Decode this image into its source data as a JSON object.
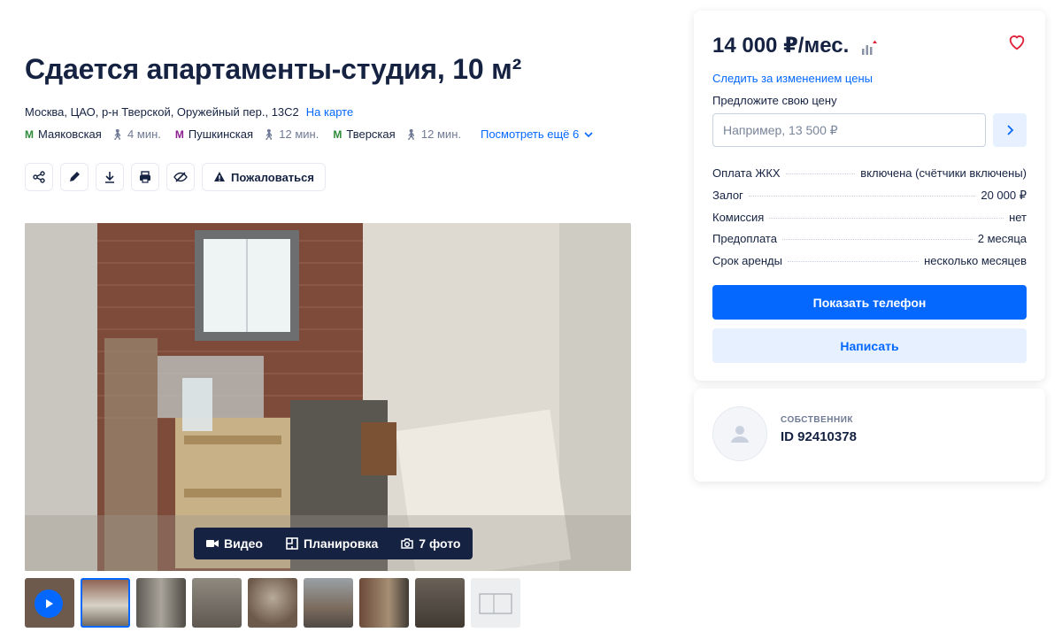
{
  "listing": {
    "title": "Сдается апартаменты-студия, 10 м²",
    "address": "Москва, ЦАО, р-н Тверской, Оружейный пер., 13С2",
    "map_link": "На карте",
    "metro": [
      {
        "name": "Маяковская",
        "walk": "4 мин.",
        "color": "#2e8b3a",
        "symbol": "M"
      },
      {
        "name": "Пушкинская",
        "walk": "12 мин.",
        "color": "#8b1f8e",
        "symbol": "M"
      },
      {
        "name": "Тверская",
        "walk": "12 мин.",
        "color": "#2e8b3a",
        "symbol": "M"
      }
    ],
    "more_metro": "Посмотреть ещё 6",
    "complain": "Пожаловаться"
  },
  "gallery": {
    "video": "Видео",
    "plan": "Планировка",
    "photos": "7 фото",
    "thumb_count": 9
  },
  "sidebar": {
    "price": "14 000 ₽/мес.",
    "follow_price": "Следить за изменением цены",
    "offer_label": "Предложите свою цену",
    "offer_placeholder": "Например, 13 500 ₽",
    "facts": [
      {
        "label": "Оплата ЖКХ",
        "value": "включена (счётчики включены)"
      },
      {
        "label": "Залог",
        "value": "20 000 ₽"
      },
      {
        "label": "Комиссия",
        "value": "нет"
      },
      {
        "label": "Предоплата",
        "value": "2 месяца"
      },
      {
        "label": "Срок аренды",
        "value": "несколько месяцев"
      }
    ],
    "show_phone": "Показать телефон",
    "write": "Написать"
  },
  "owner": {
    "role": "СОБСТВЕННИК",
    "id": "ID 92410378"
  },
  "colors": {
    "accent": "#0468ff",
    "accent_light": "#e6f0ff",
    "text": "#152242"
  }
}
